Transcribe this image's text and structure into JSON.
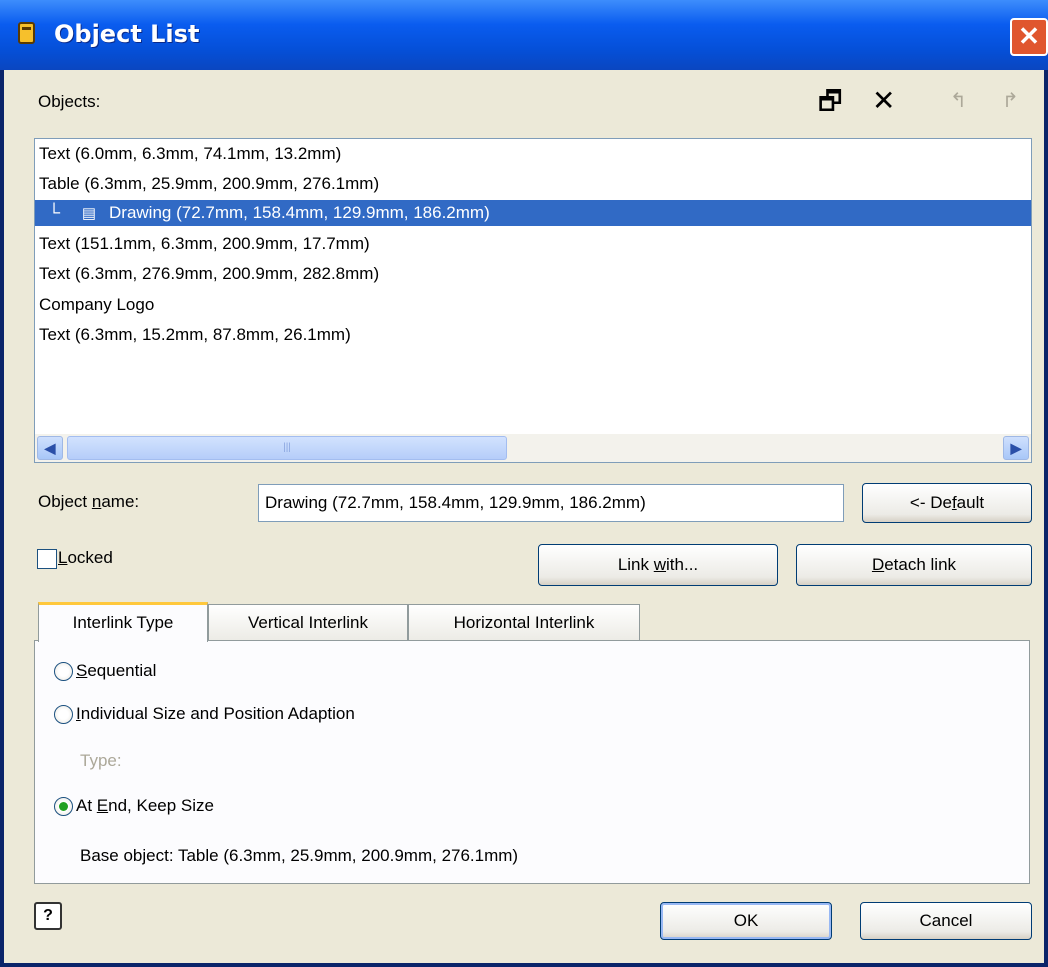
{
  "window": {
    "title": "Object List",
    "close_symbol": "✕"
  },
  "objects_label": "Objects:",
  "toolbar": [
    {
      "icon": "properties-icon",
      "glyph": "🗗"
    },
    {
      "icon": "delete-icon",
      "glyph": "✕"
    },
    {
      "icon": "move-up-icon",
      "glyph": "↰"
    },
    {
      "icon": "move-down-icon",
      "glyph": "↱"
    }
  ],
  "list_items": [
    "Text (6.0mm, 6.3mm, 74.1mm, 13.2mm)",
    "Table (6.3mm, 25.9mm, 200.9mm, 276.1mm)",
    "Drawing (72.7mm, 158.4mm, 129.9mm, 186.2mm)",
    "Text (151.1mm, 6.3mm, 200.9mm, 17.7mm)",
    "Text (6.3mm, 276.9mm, 200.9mm, 282.8mm)",
    "Company Logo",
    "Text (6.3mm, 15.2mm, 87.8mm, 26.1mm)"
  ],
  "selected_index": 2,
  "object_name": {
    "label_pre": "Object ",
    "label_u": "n",
    "label_post": "ame:",
    "value": "Drawing (72.7mm, 158.4mm, 129.9mm, 186.2mm)"
  },
  "buttons": {
    "default_pre": "<- De",
    "default_u": "f",
    "default_post": "ault",
    "link_pre": "Link ",
    "link_u": "w",
    "link_post": "ith...",
    "detach_u": "D",
    "detach_post": "etach link",
    "ok": "OK",
    "cancel": "Cancel",
    "help": "?"
  },
  "locked": {
    "label_u": "L",
    "label_post": "ocked",
    "checked": false
  },
  "tabs": [
    "Interlink Type",
    "Vertical Interlink",
    "Horizontal Interlink"
  ],
  "active_tab": 0,
  "radios": {
    "sequential_u": "S",
    "sequential_post": "equential",
    "individual_u": "I",
    "individual_post": "ndividual Size and Position Adaption",
    "type_label": "Type:",
    "atend_pre": "At ",
    "atend_u": "E",
    "atend_post": "nd, Keep Size",
    "selected": "atend"
  },
  "base_object": "Base object: Table (6.3mm, 25.9mm, 200.9mm, 276.1mm)"
}
